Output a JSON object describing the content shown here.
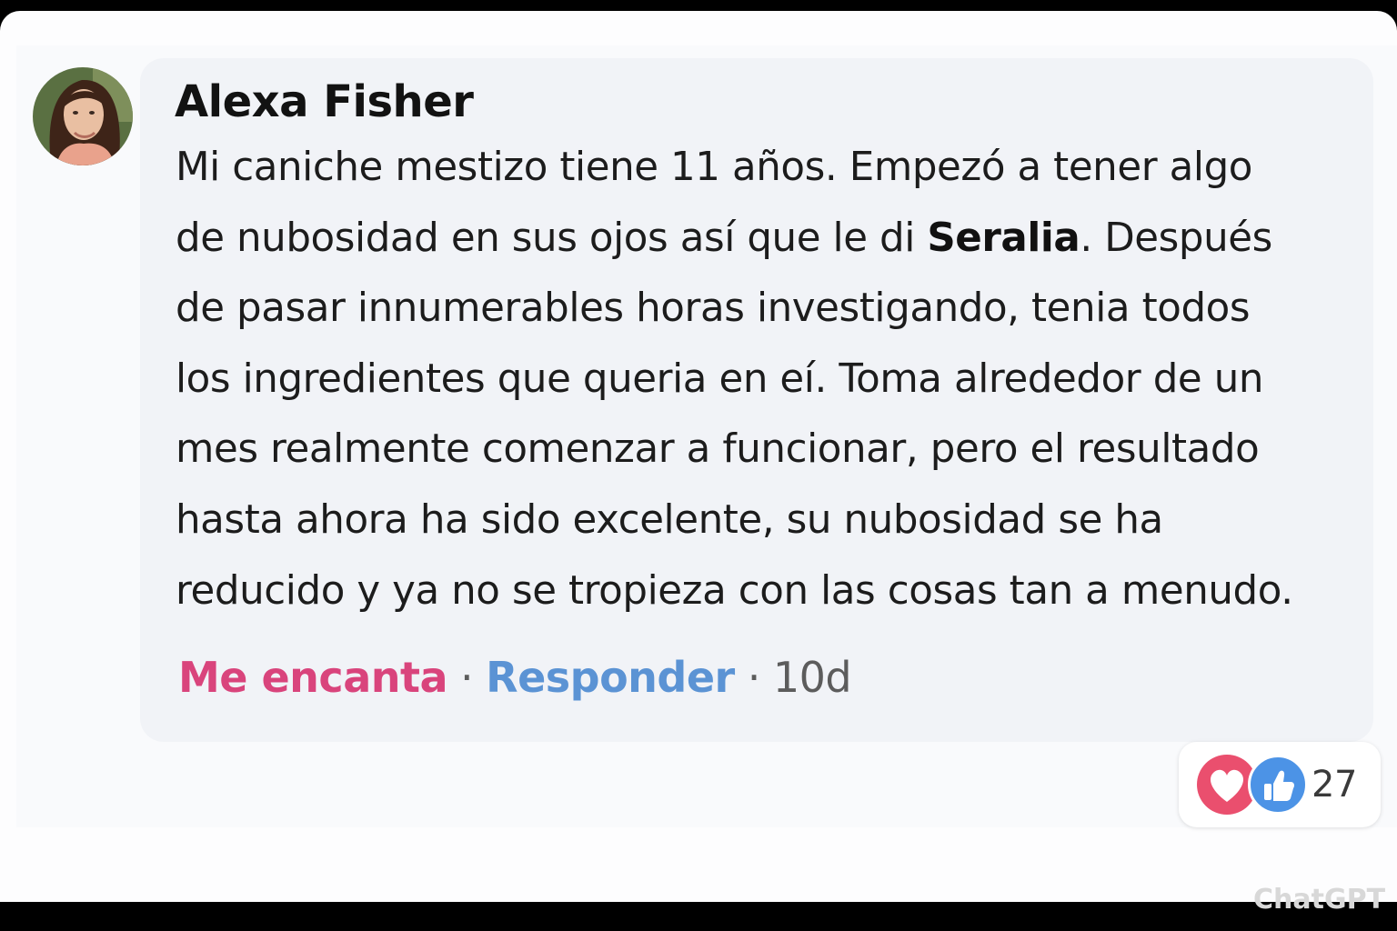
{
  "comment": {
    "author": "Alexa Fisher",
    "body_lines": [
      "Mi caniche mestizo tiene 11 años. Empezó a tener algo",
      "de nubosidad en sus ojos así que le di ",
      "Seralia",
      ". Después",
      "de pasar innumerables horas investigando, tenia todos",
      "los ingredientes que queria en eí. Toma alrededor de un",
      "mes realmente comenzar a funcionar, pero el resultado",
      "hasta ahora ha sido excelente, su nubosidad se ha",
      "reducido y ya no se tropieza con las cosas tan a menudo."
    ],
    "actions": {
      "love_label": "Me encanta",
      "reply_label": "Responder",
      "separator": "·",
      "timestamp": "10d"
    },
    "reactions": {
      "icons": [
        "heart-icon",
        "thumbs-up-icon"
      ],
      "count": "27"
    }
  },
  "watermark": "ChatGPT",
  "colors": {
    "love": "#d9447c",
    "reply": "#5b93d4",
    "heart_badge": "#ea4f6e",
    "like_badge": "#4c93e6"
  }
}
